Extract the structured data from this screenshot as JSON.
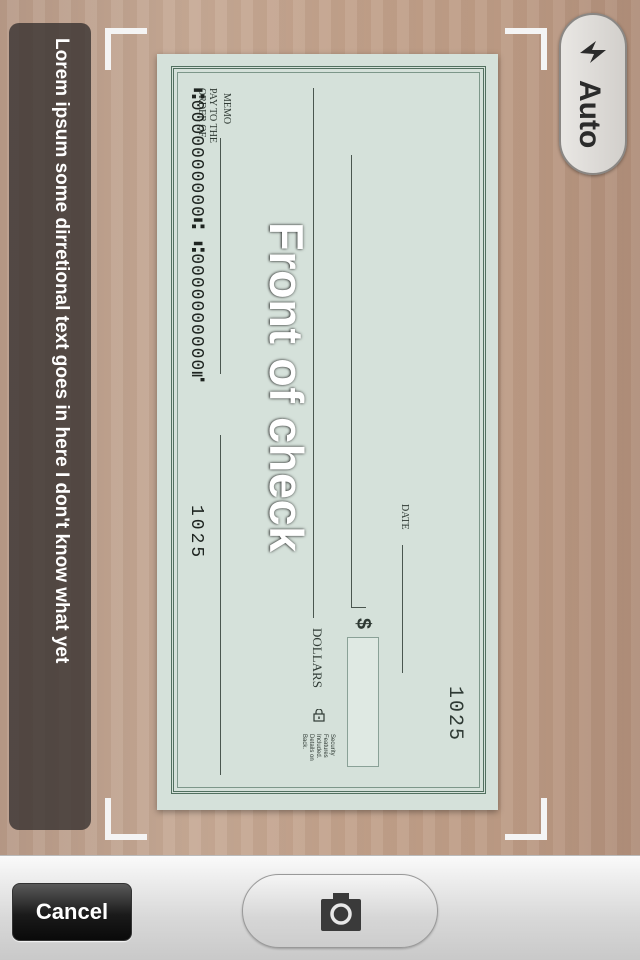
{
  "check": {
    "pay_to_label": "PAY TO THE ORDER OF",
    "memo_label": "MEMO",
    "date_label": "DATE",
    "dollar_sign": "$",
    "dollars_label": "DOLLARS",
    "check_number": "1025",
    "micr_routing": "⑆0000000000⑆ ⑆0000000000⑈",
    "micr_number": "1025",
    "security_note": "Security Features Included. Details on Back."
  },
  "overlay": {
    "title": "Front of check"
  },
  "instructions": {
    "text": "Lorem ipsum some dirretional text goes in here I don't know what yet"
  },
  "flash": {
    "label": "Auto",
    "icon": "lightning-bolt-icon"
  },
  "toolbar": {
    "cancel_label": "Cancel",
    "shutter_icon": "camera-icon"
  },
  "colors": {
    "panel": "#34302e",
    "check_paper": "#d5e1da",
    "check_border": "#51705f",
    "cancel_button": "#1a1a1a"
  }
}
